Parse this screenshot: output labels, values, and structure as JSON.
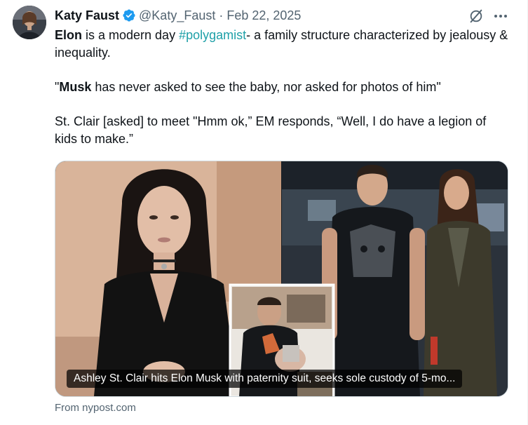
{
  "author": {
    "display_name": "Katy Faust",
    "handle": "@Katy_Faust",
    "separator": "·",
    "date": "Feb 22, 2025",
    "verified": true,
    "avatar": "avatar-photo"
  },
  "actions": {
    "grok_icon": "grok-icon",
    "more_icon": "more-icon",
    "more_label": "···"
  },
  "tweet": {
    "p1_bold": "Elon",
    "p1_a": " is a modern day ",
    "p1_hashtag": "#polygamist",
    "p1_b": "- a family structure characterized by jealousy & inequality.",
    "p2_open": "\"",
    "p2_bold": "Musk",
    "p2_rest": " has never asked to see the baby, nor asked for photos of him\"",
    "p3": "St. Clair [asked] to meet \"Hmm ok,” EM responds, “Well, I do have a legion of kids to make.”"
  },
  "card": {
    "caption": "Ashley St. Clair hits Elon Musk with paternity suit, seeks sole custody of 5-mo...",
    "source": "From nypost.com"
  },
  "colors": {
    "text": "#0f1419",
    "secondary": "#536471",
    "hashtag": "#1fa0a8",
    "verified": "#1d9bf0"
  }
}
